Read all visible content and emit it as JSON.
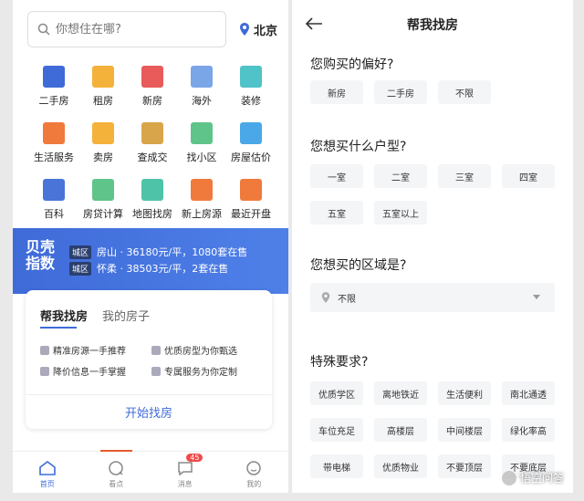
{
  "left": {
    "search": {
      "placeholder": "你想住在哪?"
    },
    "city": "北京",
    "grid": [
      {
        "label": "二手房",
        "icon": "house-icon",
        "color": "#3f6bd8"
      },
      {
        "label": "租房",
        "icon": "door-icon",
        "color": "#f5b23a"
      },
      {
        "label": "新房",
        "icon": "building-icon",
        "color": "#e95a5a"
      },
      {
        "label": "海外",
        "icon": "plane-icon",
        "color": "#7aa6e8"
      },
      {
        "label": "装修",
        "icon": "sofa-icon",
        "color": "#4fc3c7"
      },
      {
        "label": "生活服务",
        "icon": "truck-icon",
        "color": "#f07a3c"
      },
      {
        "label": "卖房",
        "icon": "tag-icon",
        "color": "#f5b23a"
      },
      {
        "label": "查成交",
        "icon": "hammer-icon",
        "color": "#d9a54a"
      },
      {
        "label": "找小区",
        "icon": "community-icon",
        "color": "#5fc48a"
      },
      {
        "label": "房屋估价",
        "icon": "pie-chart-icon",
        "color": "#4aa8e8"
      },
      {
        "label": "百科",
        "icon": "book-icon",
        "color": "#4a74d8"
      },
      {
        "label": "房贷计算",
        "icon": "calculator-icon",
        "color": "#5fc48a"
      },
      {
        "label": "地图找房",
        "icon": "map-pin-icon",
        "color": "#4fc3a7"
      },
      {
        "label": "新上房源",
        "icon": "new-listing-icon",
        "color": "#f07a3c"
      },
      {
        "label": "最近开盘",
        "icon": "sale-icon",
        "color": "#f07a3c"
      }
    ],
    "banner": {
      "brand": "贝壳指数",
      "rows": [
        {
          "tag": "城区",
          "text": "房山 · 36180元/平，1080套在售"
        },
        {
          "tag": "城区",
          "text": "怀柔 · 38503元/平，2套在售"
        }
      ]
    },
    "card": {
      "tabs": [
        "帮我找房",
        "我的房子"
      ],
      "features": [
        "精准房源一手推荐",
        "优质房型为你甄选",
        "降价信息一手掌握",
        "专属服务为你定制"
      ],
      "start": "开始找房"
    },
    "tabbar": [
      {
        "label": "首页",
        "icon": "home-icon",
        "active": true
      },
      {
        "label": "看点",
        "icon": "discover-icon"
      },
      {
        "label": "消息",
        "icon": "message-icon",
        "badge": "45"
      },
      {
        "label": "我的",
        "icon": "profile-icon"
      }
    ]
  },
  "right": {
    "title": "帮我找房",
    "q1": "您购买的偏好?",
    "pref": [
      "新房",
      "二手房",
      "不限"
    ],
    "q2": "您想买什么户型?",
    "rooms": [
      "一室",
      "二室",
      "三室",
      "四室",
      "五室",
      "五室以上"
    ],
    "q3": "您想买的区域是?",
    "region": "不限",
    "q4": "特殊要求?",
    "special": [
      "优质学区",
      "离地铁近",
      "生活便利",
      "南北通透",
      "车位充足",
      "高楼层",
      "中间楼层",
      "绿化率高",
      "带电梯",
      "优质物业",
      "不要顶层",
      "不要底层"
    ],
    "watermark": "悟空问答"
  }
}
